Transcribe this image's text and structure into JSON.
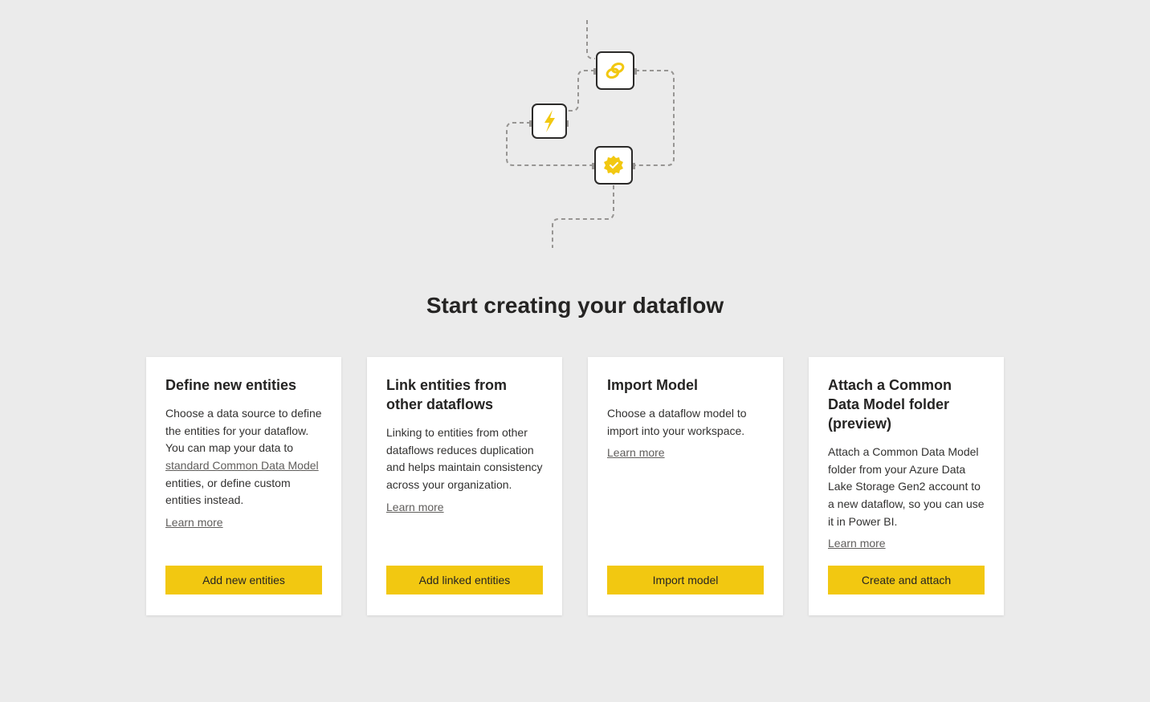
{
  "page": {
    "title": "Start creating your dataflow"
  },
  "cards": [
    {
      "title": "Define new entities",
      "desc_pre": "Choose a data source to define the entities for your dataflow. You can map your data to ",
      "desc_link": "standard Common Data Model",
      "desc_post": " entities, or define custom entities instead.",
      "learn_more": "Learn more",
      "button": "Add new entities"
    },
    {
      "title": "Link entities from other dataflows",
      "desc": "Linking to entities from other dataflows reduces duplication and helps maintain consistency across your organization.",
      "learn_more": "Learn more",
      "button": "Add linked entities"
    },
    {
      "title": "Import Model",
      "desc": "Choose a dataflow model to import into your workspace.",
      "learn_more": "Learn more",
      "button": "Import model"
    },
    {
      "title": "Attach a Common Data Model folder (preview)",
      "desc": "Attach a Common Data Model folder from your Azure Data Lake Storage Gen2 account to a new dataflow, so you can use it in Power BI.",
      "learn_more": "Learn more",
      "button": "Create and attach"
    }
  ]
}
